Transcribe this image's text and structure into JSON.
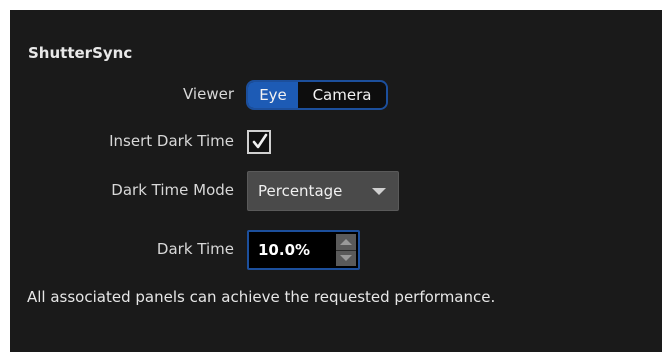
{
  "panel": {
    "title": "ShutterSync"
  },
  "viewer": {
    "label": "Viewer",
    "options": [
      "Eye",
      "Camera"
    ],
    "selected": "Eye"
  },
  "insert_dark_time": {
    "label": "Insert Dark Time",
    "checked": true,
    "icon": "checkmark-icon"
  },
  "dark_time_mode": {
    "label": "Dark Time Mode",
    "value": "Percentage",
    "icon": "chevron-down-icon"
  },
  "dark_time": {
    "label": "Dark Time",
    "value": "10.0%"
  },
  "status": {
    "message": "All associated panels can achieve the requested performance."
  },
  "colors": {
    "background": "#1a1a1a",
    "accent": "#1d5bb5",
    "accent_border": "#1c4f9c",
    "dropdown_bg": "#4a4a4a"
  }
}
